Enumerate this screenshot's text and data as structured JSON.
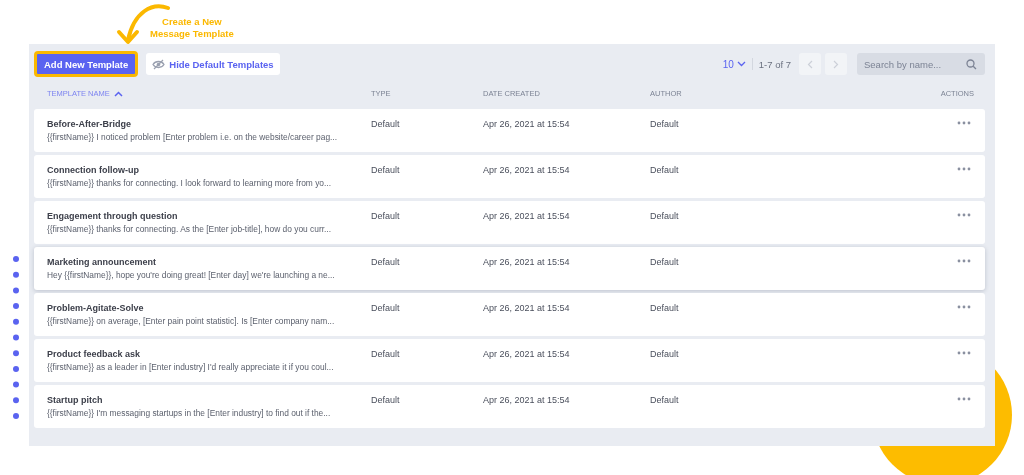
{
  "callout": {
    "text": "Create a New\nMessage Template"
  },
  "toolbar": {
    "add_button": "Add New Template",
    "hide_button": "Hide Default Templates",
    "page_size": "10",
    "range": "1-7 of 7",
    "prev_disabled": true,
    "next_disabled": true,
    "search": {
      "placeholder": "Search by name..."
    }
  },
  "table": {
    "columns": [
      {
        "label": "TEMPLATE NAME",
        "sorted": true
      },
      {
        "label": "TYPE",
        "sorted": false
      },
      {
        "label": "DATE CREATED",
        "sorted": false
      },
      {
        "label": "AUTHOR",
        "sorted": false
      },
      {
        "label": "ACTIONS",
        "sorted": false
      }
    ],
    "rows": [
      {
        "name": "Before-After-Bridge",
        "snippet": "{{firstName}} I noticed problem [Enter problem i.e. on the website/career pag...",
        "type": "Default",
        "date": "Apr 26, 2021 at 15:54",
        "author": "Default",
        "hovered": false
      },
      {
        "name": "Connection follow-up",
        "snippet": "{{firstName}} thanks for connecting. I look forward to learning more from yo...",
        "type": "Default",
        "date": "Apr 26, 2021 at 15:54",
        "author": "Default",
        "hovered": false
      },
      {
        "name": "Engagement through question",
        "snippet": "{{firstName}} thanks for connecting. As the [Enter job-title], how do you curr...",
        "type": "Default",
        "date": "Apr 26, 2021 at 15:54",
        "author": "Default",
        "hovered": false
      },
      {
        "name": "Marketing announcement",
        "snippet": "Hey {{firstName}}, hope you're doing great! [Enter day] we're launching a ne...",
        "type": "Default",
        "date": "Apr 26, 2021 at 15:54",
        "author": "Default",
        "hovered": true
      },
      {
        "name": "Problem-Agitate-Solve",
        "snippet": "{{firstName}} on average, [Enter pain point statistic]. Is [Enter company nam...",
        "type": "Default",
        "date": "Apr 26, 2021 at 15:54",
        "author": "Default",
        "hovered": false
      },
      {
        "name": "Product feedback ask",
        "snippet": "{{firstName}} as a leader in [Enter industry] I'd really appreciate it if you coul...",
        "type": "Default",
        "date": "Apr 26, 2021 at 15:54",
        "author": "Default",
        "hovered": false
      },
      {
        "name": "Startup pitch",
        "snippet": "{{firstName}} I'm messaging startups in the [Enter industry] to find out if the...",
        "type": "Default",
        "date": "Apr 26, 2021 at 15:54",
        "author": "Default",
        "hovered": false
      }
    ]
  }
}
